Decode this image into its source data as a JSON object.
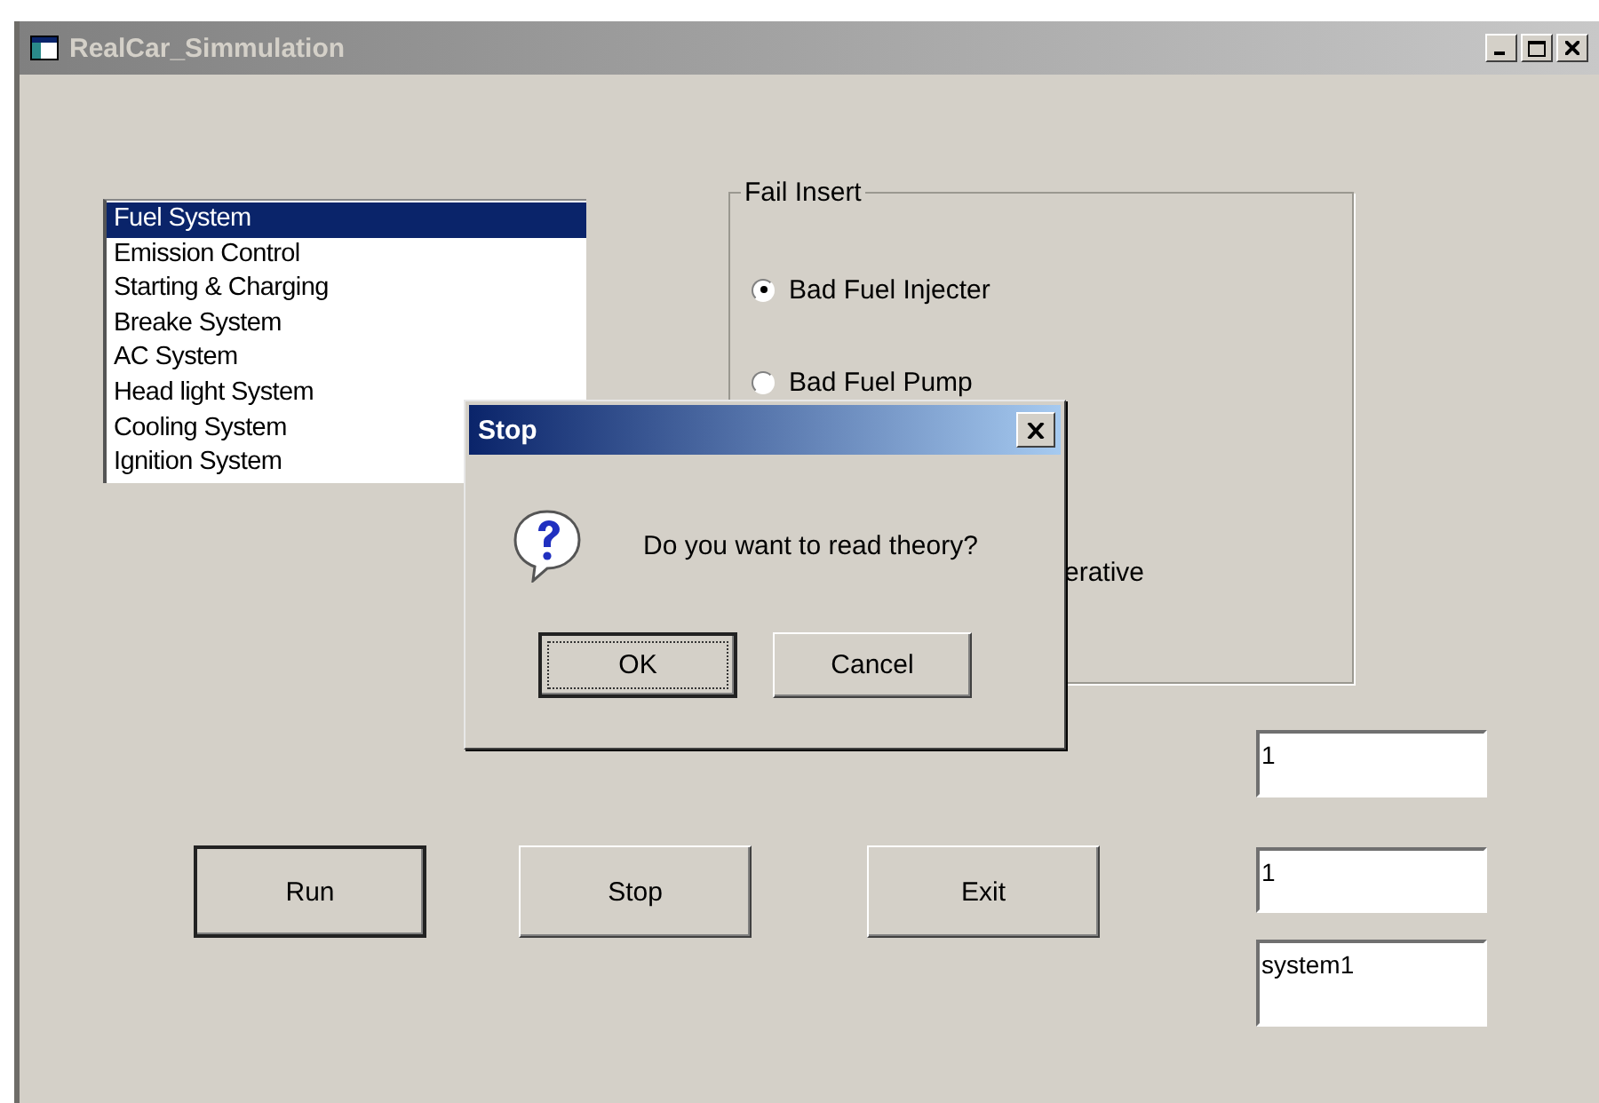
{
  "window": {
    "title": "RealCar_Simmulation",
    "active": false
  },
  "systems": [
    {
      "label": "Fuel System",
      "selected": true
    },
    {
      "label": "Emission Control",
      "selected": false
    },
    {
      "label": "Starting & Charging",
      "selected": false
    },
    {
      "label": "Breake System",
      "selected": false
    },
    {
      "label": "AC System",
      "selected": false
    },
    {
      "label": "Head light System",
      "selected": false
    },
    {
      "label": "Cooling System",
      "selected": false
    },
    {
      "label": "Ignition System",
      "selected": false
    }
  ],
  "fail_insert": {
    "title": "Fail Insert",
    "options": [
      {
        "kind": "radio",
        "label": "Bad Fuel Injecter",
        "selected": true
      },
      {
        "kind": "radio",
        "label": "Bad Fuel Pump",
        "selected": false
      },
      {
        "kind": "covered",
        "label": "erative"
      }
    ]
  },
  "buttons": [
    {
      "label": "Run",
      "default": true
    },
    {
      "label": "Stop",
      "default": false
    },
    {
      "label": "Exit",
      "default": false
    }
  ],
  "fields": [
    {
      "value": "1"
    },
    {
      "value": "1"
    },
    {
      "value": "system1"
    }
  ],
  "dialog": {
    "title": "Stop",
    "message": "Do you want to read theory?",
    "buttons": [
      {
        "label": "OK",
        "focused": true
      },
      {
        "label": "Cancel",
        "focused": false
      }
    ]
  }
}
